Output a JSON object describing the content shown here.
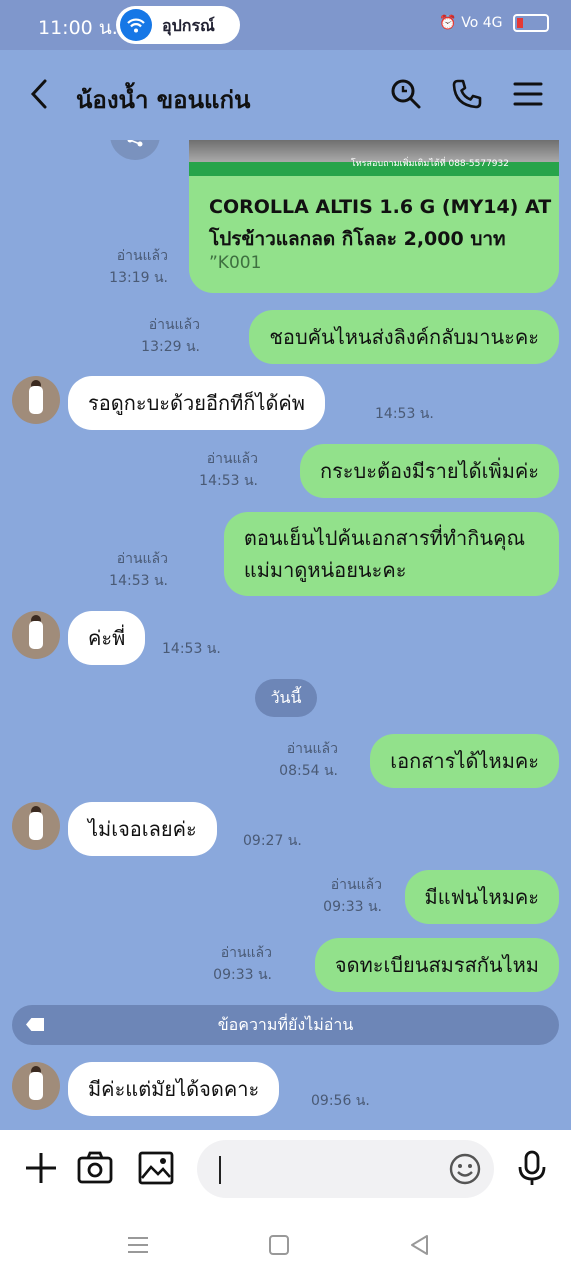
{
  "status_bar": {
    "time": "11:00 น.",
    "pill_text": "อุปกรณ์",
    "indicators": "⏰ Vo 4G"
  },
  "header": {
    "title": "น้องน้ำ ขอนแก่น",
    "icons": [
      "back-icon",
      "search-icon",
      "phone-icon",
      "menu-icon"
    ]
  },
  "card": {
    "image_text": "โทรสอบถามเพิ่มเติมได้ที่ 088-5577932",
    "line1": "COROLLA ALTIS 1.6 G (MY14) AT",
    "line2": "โปรข้าวแลกลด กิโลละ 2,000 บาท",
    "line3": "”K001",
    "read": "อ่านแล้ว",
    "time": "13:19 น."
  },
  "messages": [
    {
      "dir": "out",
      "text": "ชอบคันไหนส่งลิงค์กลับมานะคะ",
      "read": "อ่านแล้ว",
      "time": "13:29 น."
    },
    {
      "dir": "in",
      "text": "รอดูกะบะด้วยอีกทีก็ได้ค่พ",
      "time": "14:53 น."
    },
    {
      "dir": "out",
      "text": "กระบะต้องมีรายได้เพิ่มค่ะ",
      "read": "อ่านแล้ว",
      "time": "14:53 น."
    },
    {
      "dir": "out",
      "text_lines": [
        "ตอนเย็นไปค้นเอกสารที่ทำกินคุณ",
        "แม่มาดูหน่อยนะคะ"
      ],
      "read": "อ่านแล้ว",
      "time": "14:53 น."
    },
    {
      "dir": "in",
      "text": "ค่ะพี่",
      "time": "14:53 น."
    },
    {
      "dir": "out",
      "text": "เอกสารได้ไหมคะ",
      "read": "อ่านแล้ว",
      "time": "08:54 น."
    },
    {
      "dir": "in",
      "text": "ไม่เจอเลยค่ะ",
      "time": "09:27 น."
    },
    {
      "dir": "out",
      "text": "มีแฟนไหมคะ",
      "read": "อ่านแล้ว",
      "time": "09:33 น."
    },
    {
      "dir": "out",
      "text": "จดทะเบียนสมรสกันไหม",
      "read": "อ่านแล้ว",
      "time": "09:33 น."
    },
    {
      "dir": "in",
      "text": "มีค่ะแต่มัยได้จดคาะ",
      "time": "09:56 น."
    }
  ],
  "date_separator": "วันนี้",
  "unread_banner": "ข้อความที่ยังไม่อ่าน",
  "input": {
    "placeholder": ""
  },
  "colors": {
    "chat_bg": "#8aa8dc",
    "outgoing": "#92e18b",
    "incoming": "#ffffff",
    "pill": "#6d86b7"
  }
}
